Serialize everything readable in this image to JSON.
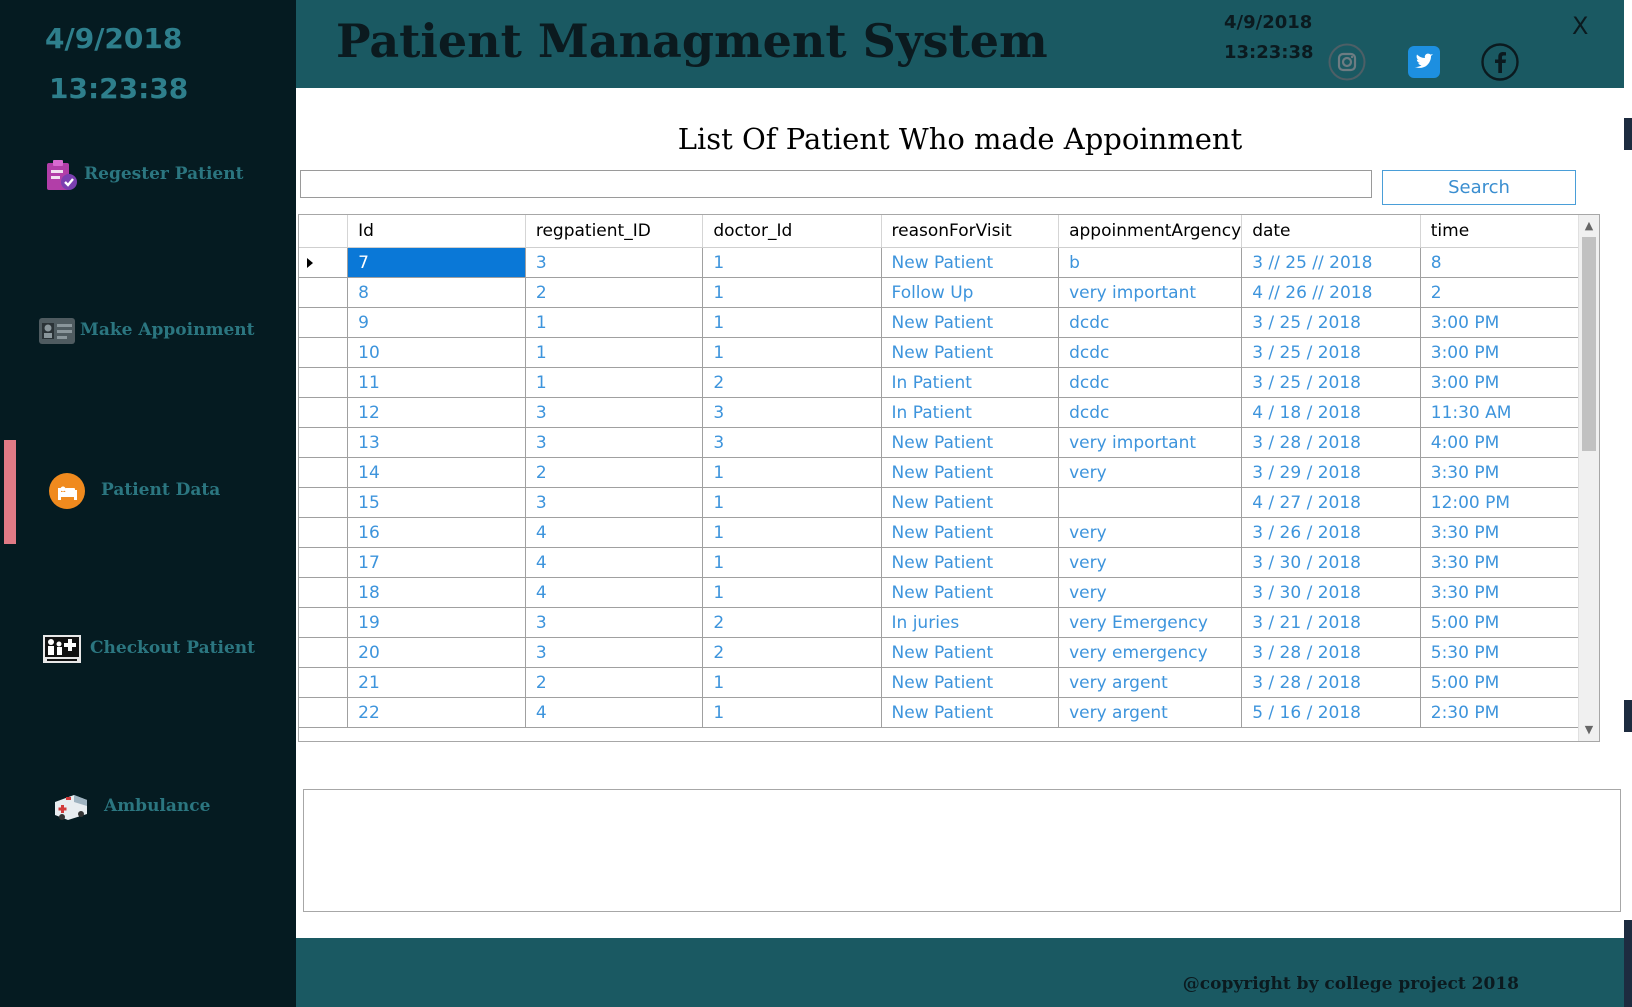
{
  "colors": {
    "sidebar_bg": "#051b21",
    "header_bg": "#1a5962",
    "accent_text": "#2e7f8c",
    "cell_text": "#3d94dc",
    "selected": "#0a78d7",
    "active_marker": "#e07a85"
  },
  "sidebar": {
    "date": "4/9/2018",
    "time": "13:23:38",
    "items": [
      {
        "label": "Regester Patient",
        "icon": "register-clipboard-icon"
      },
      {
        "label": "Make Appoinment",
        "icon": "id-card-icon"
      },
      {
        "label": "Patient Data",
        "icon": "patient-bed-icon"
      },
      {
        "label": "Checkout Patient",
        "icon": "health-care-icon"
      },
      {
        "label": "Ambulance",
        "icon": "ambulance-icon"
      }
    ]
  },
  "header": {
    "title": "Patient Managment System",
    "date": "4/9/2018",
    "time": "13:23:38",
    "close": "X",
    "social": [
      "instagram-icon",
      "twitter-icon",
      "facebook-icon"
    ]
  },
  "main": {
    "list_title": "List Of Patient Who made Appoinment",
    "search_value": "",
    "search_button": "Search"
  },
  "table": {
    "columns": [
      "Id",
      "regpatient_ID",
      "doctor_Id",
      "reasonForVisit",
      "appoinmentArgency",
      "date",
      "time"
    ],
    "rows": [
      [
        "7",
        "3",
        "1",
        "New Patient",
        "b",
        "3 // 25 // 2018",
        "8"
      ],
      [
        "8",
        "2",
        "1",
        "Follow Up",
        "very important",
        "4 // 26 // 2018",
        "2"
      ],
      [
        "9",
        "1",
        "1",
        "New Patient",
        "dcdc",
        "3 / 25 / 2018",
        "3:00 PM"
      ],
      [
        "10",
        "1",
        "1",
        "New Patient",
        "dcdc",
        "3 / 25 / 2018",
        "3:00 PM"
      ],
      [
        "11",
        "1",
        "2",
        "In Patient",
        "dcdc",
        "3 / 25 / 2018",
        "3:00 PM"
      ],
      [
        "12",
        "3",
        "3",
        "In Patient",
        "dcdc",
        "4 / 18 / 2018",
        "11:30 AM"
      ],
      [
        "13",
        "3",
        "3",
        "New Patient",
        "very important",
        "3 / 28 / 2018",
        "4:00 PM"
      ],
      [
        "14",
        "2",
        "1",
        "New Patient",
        "very",
        "3 / 29 / 2018",
        "3:30 PM"
      ],
      [
        "15",
        "3",
        "1",
        "New Patient",
        "",
        "4 / 27 / 2018",
        "12:00 PM"
      ],
      [
        "16",
        "4",
        "1",
        "New Patient",
        "very",
        "3 / 26 / 2018",
        "3:30 PM"
      ],
      [
        "17",
        "4",
        "1",
        "New Patient",
        "very",
        "3 / 30 / 2018",
        "3:30 PM"
      ],
      [
        "18",
        "4",
        "1",
        "New Patient",
        "very",
        "3 / 30 / 2018",
        "3:30 PM"
      ],
      [
        "19",
        "3",
        "2",
        "In juries",
        "very Emergency",
        "3 / 21 / 2018",
        "5:00 PM"
      ],
      [
        "20",
        "3",
        "2",
        "New Patient",
        "very emergency",
        "3 / 28 / 2018",
        "5:30 PM"
      ],
      [
        "21",
        "2",
        "1",
        "New Patient",
        "very argent",
        "3 / 28 / 2018",
        "5:00 PM"
      ],
      [
        "22",
        "4",
        "1",
        "New Patient",
        "very argent",
        "5 / 16 / 2018",
        "2:30 PM"
      ]
    ],
    "selected_row": 0
  },
  "footer": {
    "copyright": "@copyright by college project 2018"
  }
}
